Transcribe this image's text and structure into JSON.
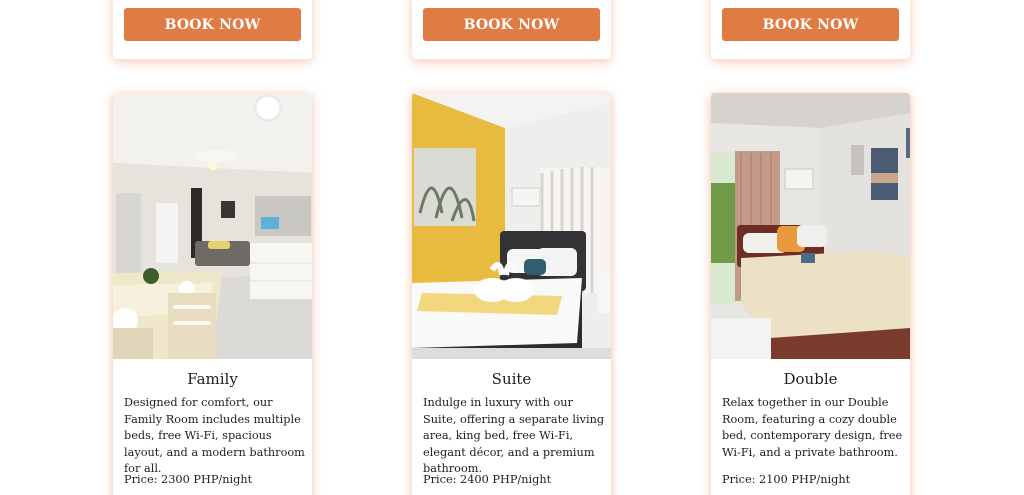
{
  "booking": {
    "button_label": "BOOK NOW"
  },
  "rooms": [
    {
      "title": "Family",
      "description": "Designed for comfort, our Family Room includes multiple beds, free Wi-Fi, spacious layout, and a modern bathroom for all.",
      "price": "Price: 2300 PHP/night"
    },
    {
      "title": "Suite",
      "description": "Indulge in luxury with our Suite, offering a separate living area, king bed, free Wi-Fi, elegant décor, and a premium bathroom.",
      "price": "Price: 2400 PHP/night"
    },
    {
      "title": "Double",
      "description": "Relax together in our Double Room, featuring a cozy double bed, contemporary design, free Wi-Fi, and a private bathroom.",
      "price": "Price: 2100 PHP/night"
    }
  ],
  "colors": {
    "accent": "#e07c43",
    "card_glow": "#f3c1a3"
  }
}
